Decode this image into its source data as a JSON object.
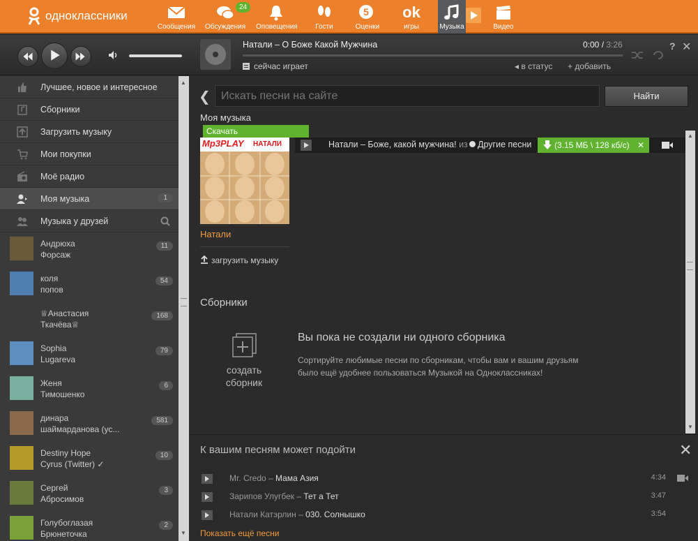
{
  "topbar": {
    "logo": "одноклассники",
    "nav": [
      {
        "label": "Сообщения",
        "icon": "envelope-icon"
      },
      {
        "label": "Обсуждения",
        "icon": "chat-icon",
        "badge": "24"
      },
      {
        "label": "Оповещения",
        "icon": "bell-icon"
      },
      {
        "label": "Гости",
        "icon": "footprints-icon"
      },
      {
        "label": "Оценки",
        "icon": "rating-icon"
      },
      {
        "label": "игры",
        "icon": "ok-games-icon"
      },
      {
        "label": "Музыка",
        "icon": "music-note-icon"
      },
      {
        "label": "Видео",
        "icon": "video-clapper-icon"
      }
    ],
    "games_glyph": "ok"
  },
  "player": {
    "track_title": "Натали – О Боже Какой Мужчина",
    "time_current": "0:00",
    "time_total": "3:26",
    "now_playing": "сейчас играет",
    "status_link": "в статус",
    "add_link": "добавить",
    "volume_level": 0.97
  },
  "sidebar": {
    "items": [
      {
        "label": "Лучшее, новое и интересное",
        "icon": "thumbs-up-icon"
      },
      {
        "label": "Сборники",
        "icon": "collection-icon"
      },
      {
        "label": "Загрузить музыку",
        "icon": "upload-icon"
      },
      {
        "label": "Мои покупки",
        "icon": "cart-icon"
      },
      {
        "label": "Моё радио",
        "icon": "radio-icon"
      },
      {
        "label": "Моя музыка",
        "icon": "user-music-icon",
        "count": "1"
      },
      {
        "label": "Музыка у друзей",
        "icon": "friends-icon"
      }
    ],
    "friends": [
      {
        "line1": "Андрюха",
        "line2": "Форсаж",
        "count": "11",
        "color": "#6b5a3a"
      },
      {
        "line1": "коля",
        "line2": "попов",
        "count": "54",
        "color": "#4f7fb0"
      },
      {
        "line1": "♕Анастасия",
        "line2": "Ткачёва♕",
        "count": "168",
        "color": "#3a3a3a"
      },
      {
        "line1": "Sophia",
        "line2": "Lugareva",
        "count": "79",
        "color": "#5a8fbf"
      },
      {
        "line1": "Женя",
        "line2": "Тимошенко",
        "count": "6",
        "color": "#7ab0a0"
      },
      {
        "line1": "динара",
        "line2": "шаймарданова (ус...",
        "count": "581",
        "color": "#8a6a4a"
      },
      {
        "line1": "Destiny Hope",
        "line2": "Cyrus (Twitter) ✓",
        "count": "10",
        "color": "#b59a2a"
      },
      {
        "line1": "Сергей",
        "line2": "Абросимов",
        "count": "3",
        "color": "#6a7a3a"
      },
      {
        "line1": "Голубоглазая",
        "line2": "Брюнеточка",
        "count": "2",
        "color": "#7aa03a"
      }
    ]
  },
  "main": {
    "search_placeholder": "Искать песни на сайте",
    "search_button": "Найти",
    "my_music_label": "Моя музыка",
    "tooltip": "Скачать",
    "album_logo": "Mp3PLAY",
    "album_artist_caption": "НАТАЛИ",
    "artist_link": "Натали",
    "upload_link": "загрузить музыку",
    "track": {
      "name": "Натали – Боже, какой мужчина!",
      "from": "из",
      "other_songs": "Другие песни",
      "download": "(3.15 МБ \\ 128 кб/с)"
    },
    "compilations_title": "Сборники",
    "create_label": "создать сборник",
    "empty_title": "Вы пока не создали ни одного сборника",
    "empty_desc": "Сортируйте любимые песни по сборникам, чтобы вам и вашим друзьям было ещё удобнее пользоваться Музыкой на Одноклассниках!"
  },
  "recommendations": {
    "title": "К вашим песням может подойти",
    "items": [
      {
        "artist": "Mr. Credo",
        "song": "Мама Азия",
        "time": "4:34"
      },
      {
        "artist": "Зарипов Улугбек",
        "song": "Тет а Тет",
        "time": "3:47"
      },
      {
        "artist": "Натали Катэрлин",
        "song": "030. Солнышко",
        "time": "3:54"
      }
    ],
    "more": "Показать ещё песни"
  },
  "colors": {
    "accent": "#ed812b",
    "green": "#5fb32e",
    "link": "#f39c3b"
  }
}
